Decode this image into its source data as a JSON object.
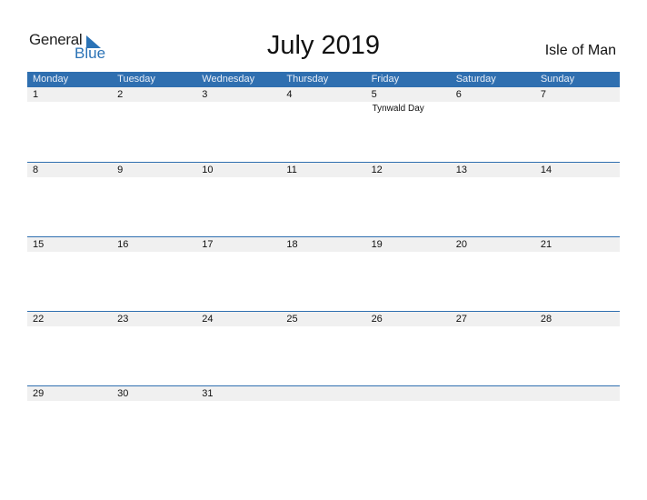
{
  "logo": {
    "general": "General",
    "blue": "Blue",
    "accent_color": "#2b73b6"
  },
  "title": "July 2019",
  "country": "Isle of Man",
  "header_color": "#2f6fb0",
  "weekdays": [
    "Monday",
    "Tuesday",
    "Wednesday",
    "Thursday",
    "Friday",
    "Saturday",
    "Sunday"
  ],
  "weeks": [
    {
      "days": [
        {
          "n": "1",
          "e": ""
        },
        {
          "n": "2",
          "e": ""
        },
        {
          "n": "3",
          "e": ""
        },
        {
          "n": "4",
          "e": ""
        },
        {
          "n": "5",
          "e": "Tynwald Day"
        },
        {
          "n": "6",
          "e": ""
        },
        {
          "n": "7",
          "e": ""
        }
      ]
    },
    {
      "days": [
        {
          "n": "8",
          "e": ""
        },
        {
          "n": "9",
          "e": ""
        },
        {
          "n": "10",
          "e": ""
        },
        {
          "n": "11",
          "e": ""
        },
        {
          "n": "12",
          "e": ""
        },
        {
          "n": "13",
          "e": ""
        },
        {
          "n": "14",
          "e": ""
        }
      ]
    },
    {
      "days": [
        {
          "n": "15",
          "e": ""
        },
        {
          "n": "16",
          "e": ""
        },
        {
          "n": "17",
          "e": ""
        },
        {
          "n": "18",
          "e": ""
        },
        {
          "n": "19",
          "e": ""
        },
        {
          "n": "20",
          "e": ""
        },
        {
          "n": "21",
          "e": ""
        }
      ]
    },
    {
      "days": [
        {
          "n": "22",
          "e": ""
        },
        {
          "n": "23",
          "e": ""
        },
        {
          "n": "24",
          "e": ""
        },
        {
          "n": "25",
          "e": ""
        },
        {
          "n": "26",
          "e": ""
        },
        {
          "n": "27",
          "e": ""
        },
        {
          "n": "28",
          "e": ""
        }
      ]
    },
    {
      "days": [
        {
          "n": "29",
          "e": ""
        },
        {
          "n": "30",
          "e": ""
        },
        {
          "n": "31",
          "e": ""
        },
        {
          "n": "",
          "e": ""
        },
        {
          "n": "",
          "e": ""
        },
        {
          "n": "",
          "e": ""
        },
        {
          "n": "",
          "e": ""
        }
      ]
    }
  ]
}
